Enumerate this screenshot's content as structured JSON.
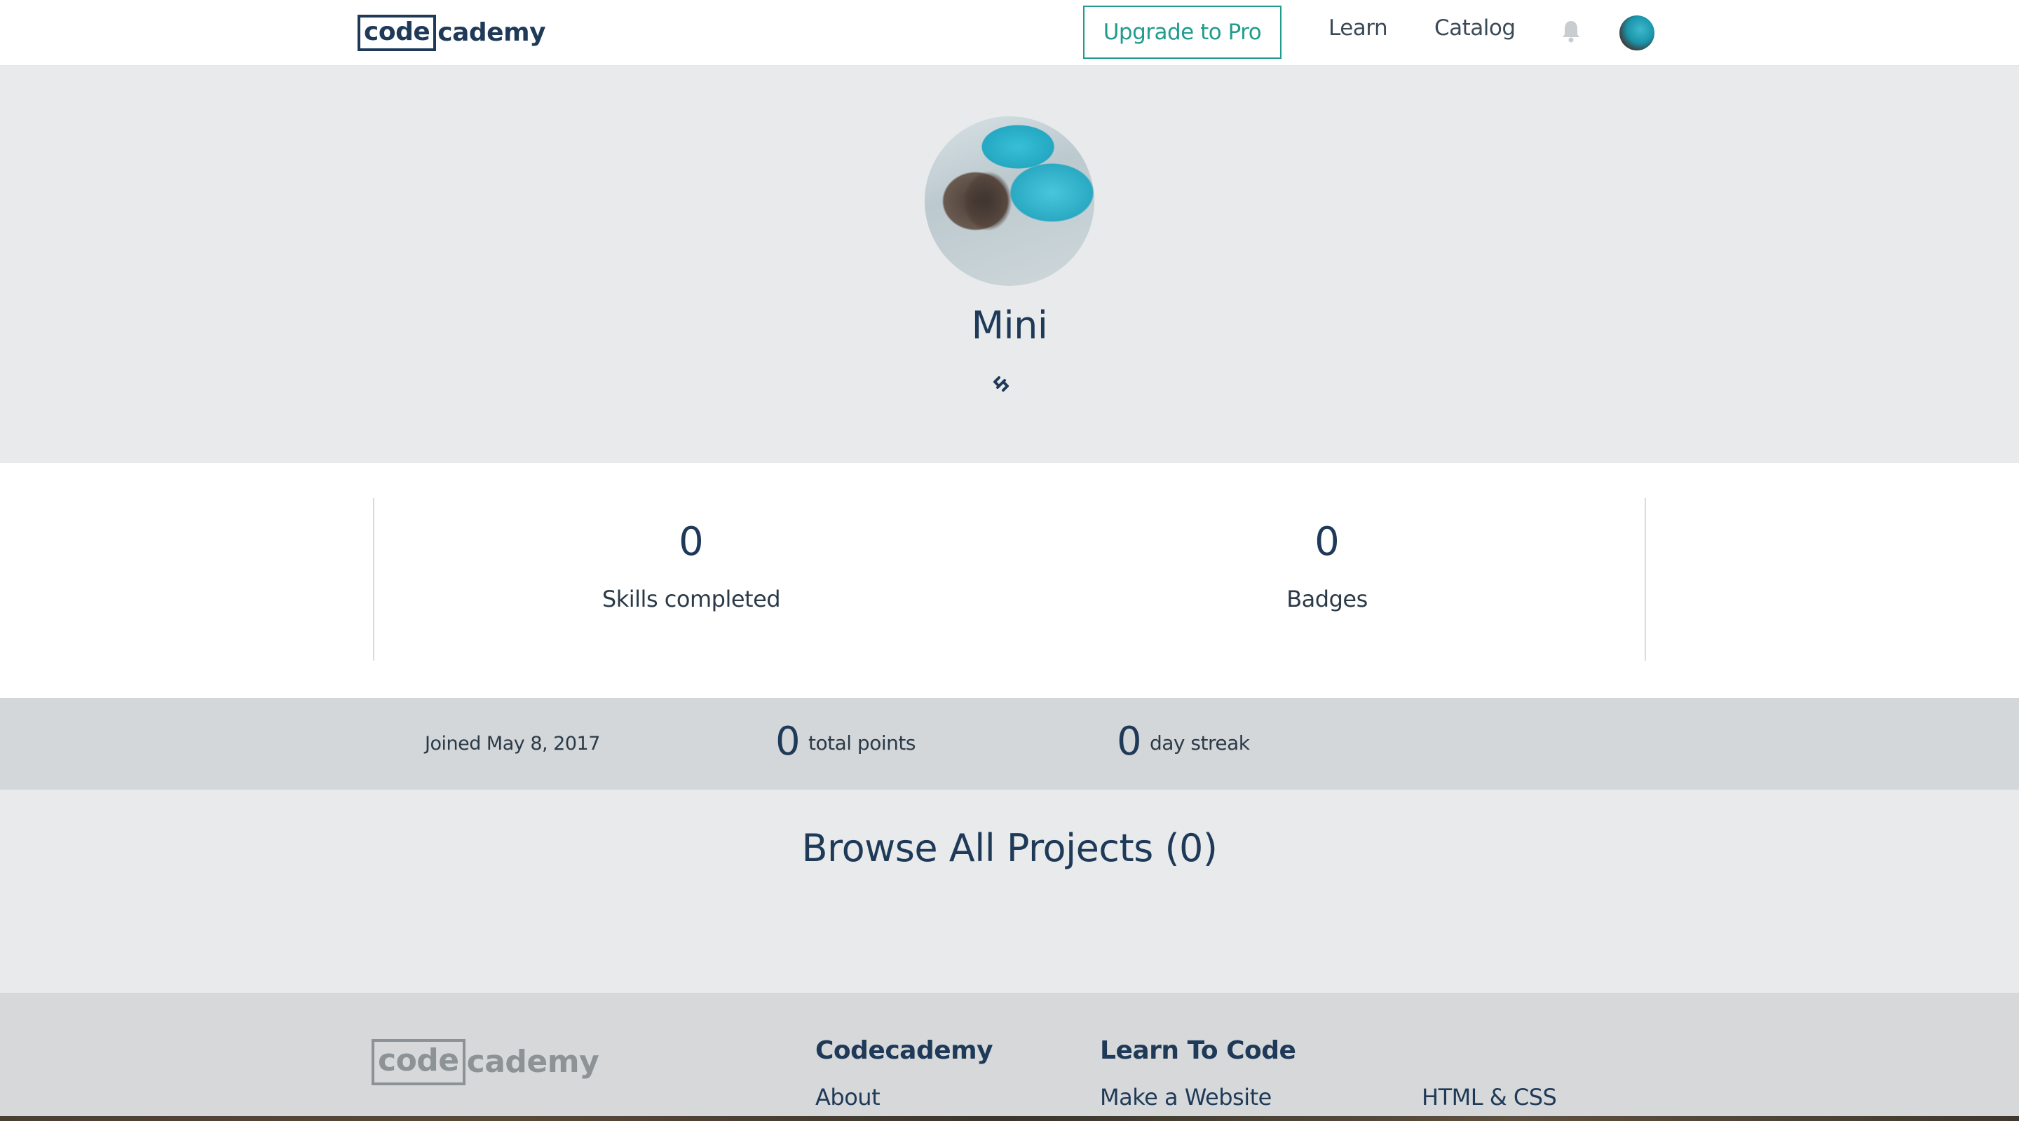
{
  "header": {
    "logo_boxed": "code",
    "logo_rest": "cademy",
    "upgrade_label": "Upgrade to Pro",
    "nav": [
      "Learn",
      "Catalog"
    ],
    "bell_icon": "bell-icon",
    "avatar_icon": "user-avatar"
  },
  "profile": {
    "name": "Mini",
    "link_icon": "link-icon"
  },
  "stats": [
    {
      "value": "0",
      "label": "Skills completed"
    },
    {
      "value": "0",
      "label": "Badges"
    }
  ],
  "info": {
    "joined": "Joined May 8, 2017",
    "total_points_value": "0",
    "total_points_label": "total points",
    "day_streak_value": "0",
    "day_streak_label": "day streak"
  },
  "projects": {
    "title": "Browse All Projects (0)"
  },
  "footer": {
    "logo_boxed": "code",
    "logo_rest": "cademy",
    "columns": [
      {
        "heading": "Codecademy",
        "links": [
          "About"
        ]
      },
      {
        "heading": "Learn To Code",
        "links": [
          "Make a Website",
          "HTML & CSS"
        ]
      }
    ]
  },
  "colors": {
    "brand_navy": "#1f3a58",
    "accent_teal": "#1f9c8e",
    "hero_bg": "#e8eaeb",
    "infobar_bg": "#d4d7d9"
  }
}
